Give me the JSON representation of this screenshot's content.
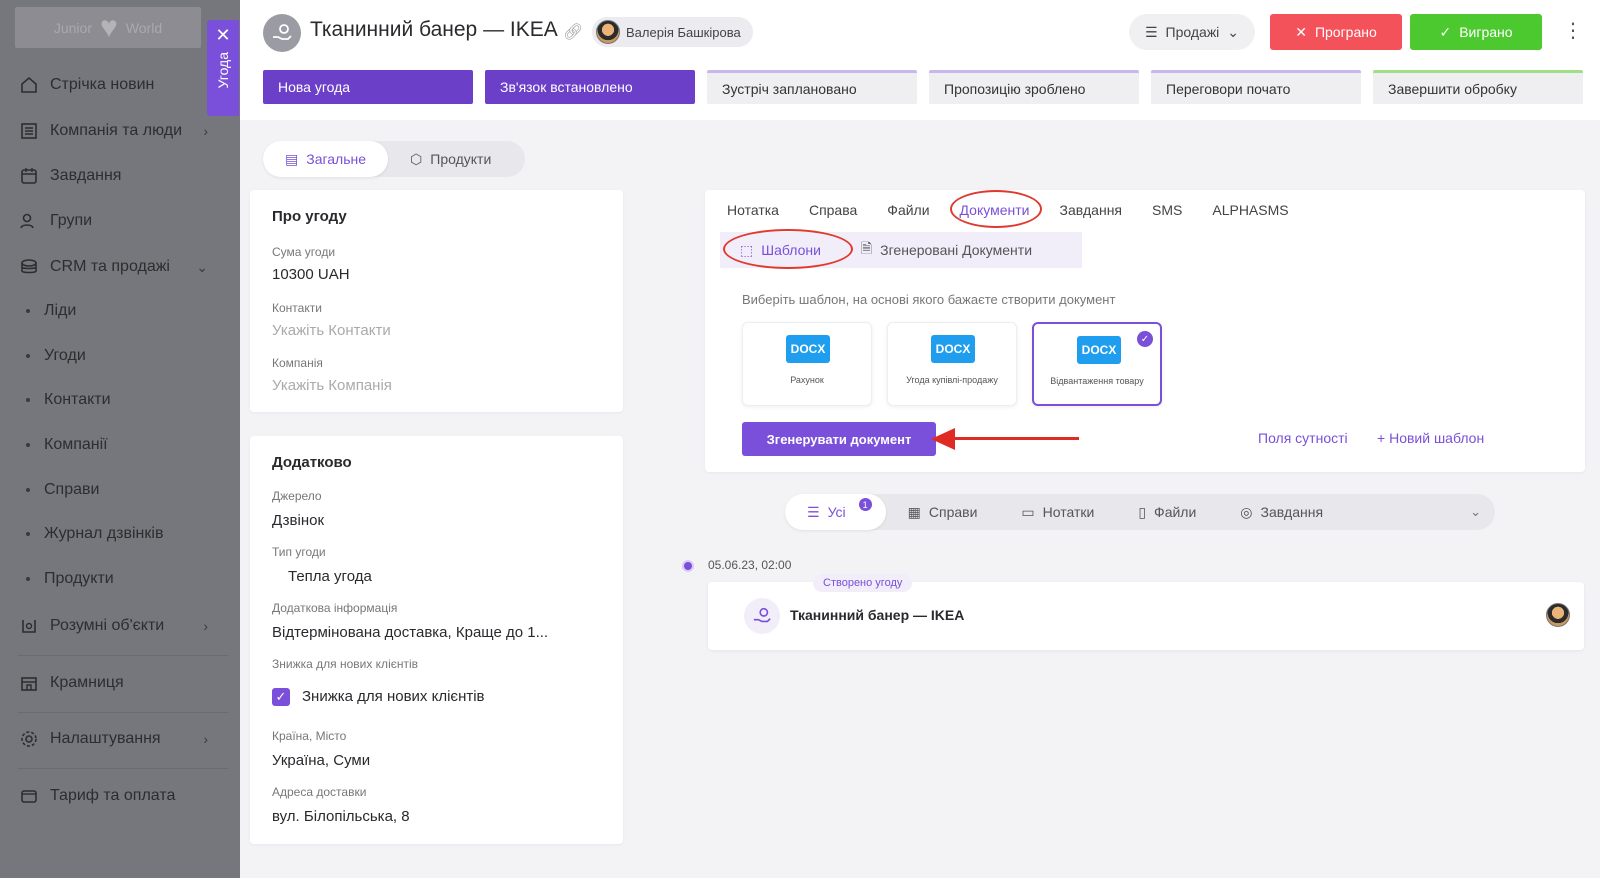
{
  "sidebar": {
    "logo_text_left": "Junior",
    "logo_text_right": "World",
    "items": [
      {
        "label": "Стрічка новин",
        "icon": "home-icon"
      },
      {
        "label": "Компанія та люди",
        "icon": "building-icon"
      },
      {
        "label": "Завдання",
        "icon": "calendar-icon"
      },
      {
        "label": "Групи",
        "icon": "users-icon"
      },
      {
        "label": "CRM та продажі",
        "icon": "coins-icon"
      },
      {
        "label": "Розумні об'єкти",
        "icon": "smart-objects-icon"
      },
      {
        "label": "Крамниця",
        "icon": "store-icon"
      },
      {
        "label": "Налаштування",
        "icon": "gear-icon"
      },
      {
        "label": "Тариф та оплата",
        "icon": "wallet-icon"
      }
    ],
    "sub_items": [
      "Ліди",
      "Угоди",
      "Контакти",
      "Компанії",
      "Справи",
      "Журнал дзвінків",
      "Продукти"
    ]
  },
  "vertical_tab": {
    "label": "Угода"
  },
  "header": {
    "title": "Тканинний банер — IKEA",
    "user_name": "Валерія Башкірова",
    "pipeline": "Продажі",
    "lost_label": "Програно",
    "won_label": "Виграно"
  },
  "stages": [
    {
      "label": "Нова угода",
      "state": "done"
    },
    {
      "label": "Зв'язок встановлено",
      "state": "done"
    },
    {
      "label": "Зустріч заплановано",
      "state": "todo"
    },
    {
      "label": "Пропозицію зроблено",
      "state": "todo"
    },
    {
      "label": "Переговори почато",
      "state": "todo"
    },
    {
      "label": "Завершити обробку",
      "state": "todo"
    }
  ],
  "main_tabs": {
    "general": "Загальне",
    "products": "Продукти"
  },
  "about": {
    "title": "Про угоду",
    "amount_label": "Сума угоди",
    "amount_value": "10300 UAH",
    "contacts_label": "Контакти",
    "contacts_placeholder": "Укажіть Контакти",
    "company_label": "Компанія",
    "company_placeholder": "Укажіть Компанія"
  },
  "extra": {
    "title": "Додатково",
    "source_label": "Джерело",
    "source_value": "Дзвінок",
    "type_label": "Тип угоди",
    "type_value": "Тепла угода",
    "info_label": "Додаткова інформація",
    "info_value": "Відтермінована доставка, Краще до 1...",
    "discount_label": "Знижка для нових клієнтів",
    "discount_value": "Знижка для нових клієнтів",
    "discount_checked": true,
    "location_label": "Країна, Місто",
    "location_value": "Україна, Суми",
    "address_label": "Адреса доставки",
    "address_value": "вул. Білопільська, 8"
  },
  "docs": {
    "tabs": [
      "Нотатка",
      "Справа",
      "Файли",
      "Документи",
      "Завдання",
      "SMS",
      "ALPHASMS"
    ],
    "active_tab": "Документи",
    "sub_tabs": {
      "templates": "Шаблони",
      "generated": "Згенеровані Документи"
    },
    "hint": "Виберіть шаблон, на основі якого бажаєте створити документ",
    "templates": [
      {
        "badge": "DOCX",
        "name": "Рахунок",
        "selected": false
      },
      {
        "badge": "DOCX",
        "name": "Угода купівлі-продажу",
        "selected": false
      },
      {
        "badge": "DOCX",
        "name": "Відвантаження товару",
        "selected": true
      }
    ],
    "generate_label": "Згенерувати документ",
    "entity_fields_label": "Поля сутності",
    "new_template_label": "Новий шаблон"
  },
  "filters": {
    "all": "Усі",
    "all_count": "1",
    "cases": "Справи",
    "notes": "Нотатки",
    "files": "Файли",
    "tasks": "Завдання"
  },
  "timeline": {
    "date": "05.06.23, 02:00",
    "tag": "Створено угоду",
    "title": "Тканинний банер — IKEA"
  },
  "colors": {
    "accent": "#7a4fd9",
    "lost": "#f4525a",
    "won": "#4cc92f",
    "docx": "#1f9ef0",
    "annotation": "#e02a24"
  }
}
